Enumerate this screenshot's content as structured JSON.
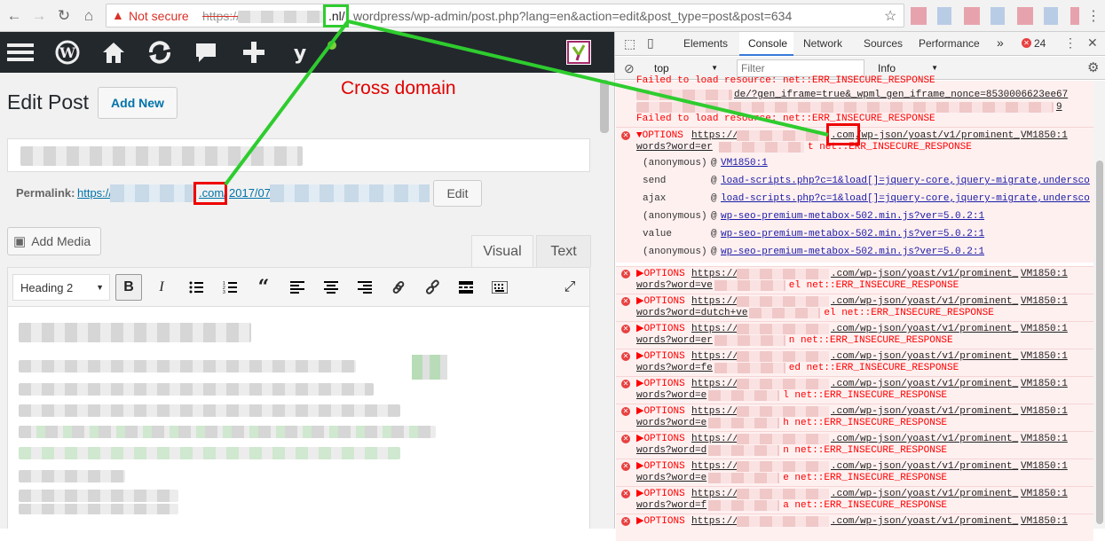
{
  "browser": {
    "security_label": "Not secure",
    "url_scheme": "https://",
    "url_tld": ".nl/",
    "url_path": "wordpress/wp-admin/post.php?lang=en&action=edit&post_type=post&post=634"
  },
  "editor": {
    "heading": "Edit Post",
    "add_new": "Add New",
    "permalink_label": "Permalink:",
    "permalink_scheme": "https://",
    "permalink_domain": ".com/",
    "permalink_date": "2017/07",
    "edit_label": "Edit",
    "add_media": "Add Media",
    "tab_visual": "Visual",
    "tab_text": "Text",
    "format_select": "Heading 2"
  },
  "annotation": {
    "label": "Cross domain",
    "color": "#e00000",
    "line_color": "#2ecc2e"
  },
  "devtools": {
    "tabs": [
      "Elements",
      "Console",
      "Network",
      "Sources",
      "Performance"
    ],
    "more": "»",
    "error_count": "24",
    "context": "top",
    "filter_placeholder": "Filter",
    "level": "Info",
    "top_lines": [
      "Failed to load resource: net::ERR_INSECURE_RESPONSE",
      "de/?gen_iframe=true&_wpml_gen_iframe_nonce=8530006623ee67",
      "9",
      "Failed to load resource: net::ERR_INSECURE_RESPONSE"
    ],
    "expanded": {
      "prefix": "▼OPTIONS",
      "scheme": "https://",
      "domain": ".com",
      "path": "/wp-json/yoast/v1/prominent_",
      "source": "VM1850:1",
      "words": "words?word=er",
      "suffix": "t net::ERR_INSECURE_RESPONSE",
      "stack": [
        {
          "fn": "(anonymous)",
          "src": "VM1850:1"
        },
        {
          "fn": "send",
          "src": "load-scripts.php?c=1&load[]=jquery-core,jquery-migrate,undersco"
        },
        {
          "fn": "ajax",
          "src": "load-scripts.php?c=1&load[]=jquery-core,jquery-migrate,undersco"
        },
        {
          "fn": "(anonymous)",
          "src": "wp-seo-premium-metabox-502.min.js?ver=5.0.2:1"
        },
        {
          "fn": "value",
          "src": "wp-seo-premium-metabox-502.min.js?ver=5.0.2:1"
        },
        {
          "fn": "(anonymous)",
          "src": "wp-seo-premium-metabox-502.min.js?ver=5.0.2:1"
        }
      ]
    },
    "errors": [
      {
        "prefix": "▶OPTIONS",
        "scheme": "https://",
        "path": ".com/wp-json/yoast/v1/prominent_",
        "source": "VM1850:1",
        "words": "words?word=ve",
        "tail": "el net::ERR_INSECURE_RESPONSE"
      },
      {
        "prefix": "▶OPTIONS",
        "scheme": "https://",
        "path": ".com/wp-json/yoast/v1/prominent_",
        "source": "VM1850:1",
        "words": "words?word=dutch+ve",
        "tail": "el net::ERR_INSECURE_RESPONSE"
      },
      {
        "prefix": "▶OPTIONS",
        "scheme": "https://",
        "path": ".com/wp-json/yoast/v1/prominent_",
        "source": "VM1850:1",
        "words": "words?word=er",
        "tail": "n net::ERR_INSECURE_RESPONSE"
      },
      {
        "prefix": "▶OPTIONS",
        "scheme": "https://",
        "path": ".com/wp-json/yoast/v1/prominent_",
        "source": "VM1850:1",
        "words": "words?word=fe",
        "tail": "ed net::ERR_INSECURE_RESPONSE"
      },
      {
        "prefix": "▶OPTIONS",
        "scheme": "https://",
        "path": ".com/wp-json/yoast/v1/prominent_",
        "source": "VM1850:1",
        "words": "words?word=e",
        "tail": "l net::ERR_INSECURE_RESPONSE"
      },
      {
        "prefix": "▶OPTIONS",
        "scheme": "https://",
        "path": ".com/wp-json/yoast/v1/prominent_",
        "source": "VM1850:1",
        "words": "words?word=e",
        "tail": "h net::ERR_INSECURE_RESPONSE"
      },
      {
        "prefix": "▶OPTIONS",
        "scheme": "https://",
        "path": ".com/wp-json/yoast/v1/prominent_",
        "source": "VM1850:1",
        "words": "words?word=d",
        "tail": "n net::ERR_INSECURE_RESPONSE"
      },
      {
        "prefix": "▶OPTIONS",
        "scheme": "https://",
        "path": ".com/wp-json/yoast/v1/prominent_",
        "source": "VM1850:1",
        "words": "words?word=e",
        "tail": "e net::ERR_INSECURE_RESPONSE"
      },
      {
        "prefix": "▶OPTIONS",
        "scheme": "https://",
        "path": ".com/wp-json/yoast/v1/prominent_",
        "source": "VM1850:1",
        "words": "words?word=f",
        "tail": "a net::ERR_INSECURE_RESPONSE"
      },
      {
        "prefix": "▶OPTIONS",
        "scheme": "https://",
        "path": ".com/wp-json/yoast/v1/prominent_",
        "source": "VM1850:1",
        "words": "",
        "tail": ""
      }
    ]
  }
}
